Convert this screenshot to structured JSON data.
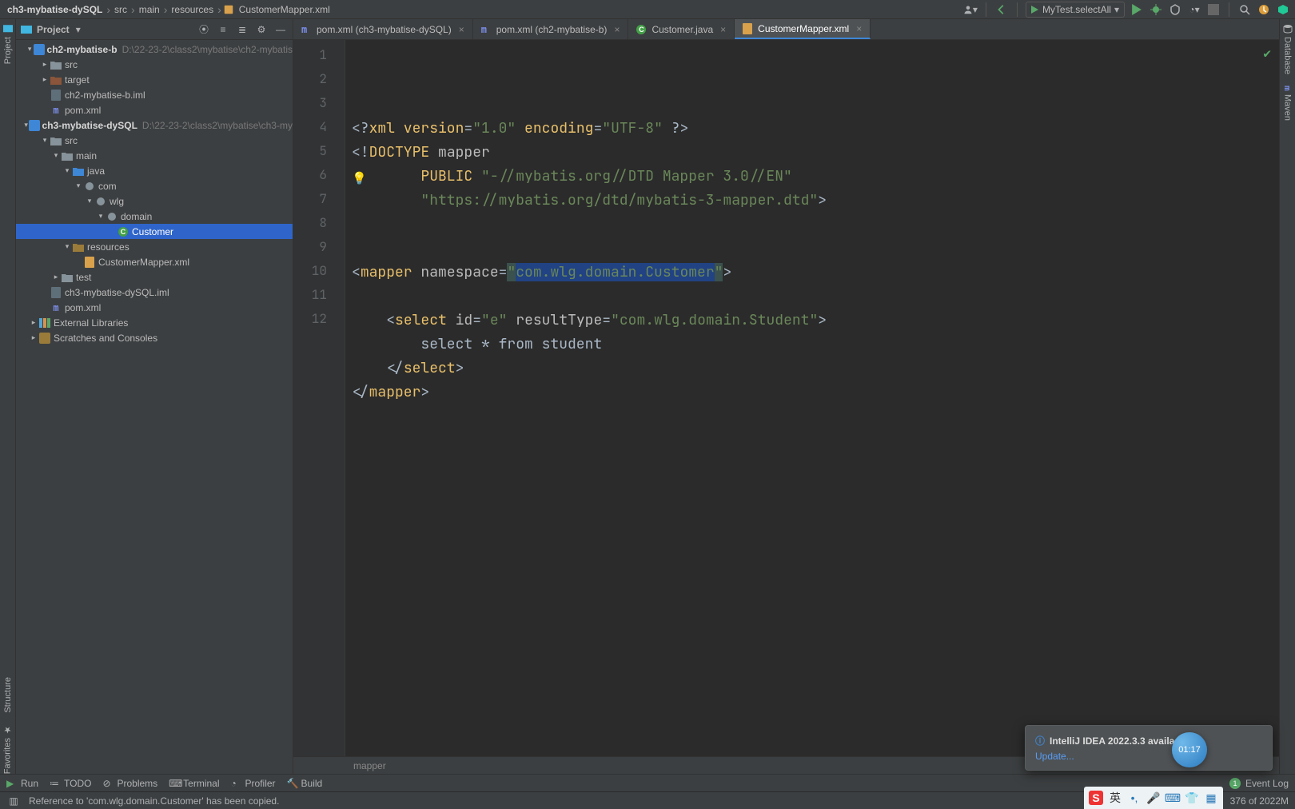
{
  "breadcrumbs": {
    "items": [
      "ch3-mybatise-dySQL",
      "src",
      "main",
      "resources",
      "CustomerMapper.xml"
    ]
  },
  "run_config": "MyTest.selectAll",
  "left_strip": {
    "project": "Project",
    "structure": "Structure",
    "favorites": "Favorites"
  },
  "right_strip": {
    "database": "Database",
    "maven": "Maven"
  },
  "project_panel": {
    "title": "Project"
  },
  "tree": [
    {
      "d": 0,
      "exp": "open",
      "icon": "module",
      "label": "ch2-mybatise-b",
      "hint": "D:\\22-23-2\\class2\\mybatise\\ch2-mybatis",
      "bold": true
    },
    {
      "d": 1,
      "exp": "closed",
      "icon": "folder",
      "label": "src"
    },
    {
      "d": 1,
      "exp": "closed",
      "icon": "folder-ex",
      "label": "target"
    },
    {
      "d": 1,
      "exp": "",
      "icon": "file",
      "label": "ch2-mybatise-b.iml"
    },
    {
      "d": 1,
      "exp": "",
      "icon": "m",
      "label": "pom.xml"
    },
    {
      "d": 0,
      "exp": "open",
      "icon": "module",
      "label": "ch3-mybatise-dySQL",
      "hint": "D:\\22-23-2\\class2\\mybatise\\ch3-my",
      "bold": true
    },
    {
      "d": 1,
      "exp": "open",
      "icon": "folder",
      "label": "src"
    },
    {
      "d": 2,
      "exp": "open",
      "icon": "folder",
      "label": "main"
    },
    {
      "d": 3,
      "exp": "open",
      "icon": "folder-blue",
      "label": "java"
    },
    {
      "d": 4,
      "exp": "open",
      "icon": "pkg",
      "label": "com"
    },
    {
      "d": 5,
      "exp": "open",
      "icon": "pkg",
      "label": "wlg"
    },
    {
      "d": 6,
      "exp": "open",
      "icon": "pkg",
      "label": "domain"
    },
    {
      "d": 7,
      "exp": "",
      "icon": "class",
      "label": "Customer",
      "selected": true
    },
    {
      "d": 3,
      "exp": "open",
      "icon": "folder-res",
      "label": "resources"
    },
    {
      "d": 4,
      "exp": "",
      "icon": "xml",
      "label": "CustomerMapper.xml"
    },
    {
      "d": 2,
      "exp": "closed",
      "icon": "folder",
      "label": "test"
    },
    {
      "d": 1,
      "exp": "",
      "icon": "file",
      "label": "ch3-mybatise-dySQL.iml"
    },
    {
      "d": 1,
      "exp": "",
      "icon": "m",
      "label": "pom.xml"
    },
    {
      "d": 0,
      "exp": "closed",
      "icon": "lib",
      "label": "External Libraries"
    },
    {
      "d": 0,
      "exp": "closed",
      "icon": "scratch",
      "label": "Scratches and Consoles"
    }
  ],
  "tabs": [
    {
      "icon": "m",
      "label": "pom.xml (ch3-mybatise-dySQL)",
      "closable": true
    },
    {
      "icon": "m",
      "label": "pom.xml (ch2-mybatise-b)",
      "closable": true
    },
    {
      "icon": "class",
      "label": "Customer.java",
      "closable": true
    },
    {
      "icon": "xml",
      "label": "CustomerMapper.xml",
      "closable": true,
      "active": true
    }
  ],
  "code": {
    "lines": [
      {
        "n": 1,
        "html": "<span class='tok-punct'>&lt;?</span><span class='tok-tag'>xml version</span><span class='tok-punct'>=</span><span class='tok-str'>\"1.0\"</span> <span class='tok-tag'>encoding</span><span class='tok-punct'>=</span><span class='tok-str'>\"UTF-8\"</span> <span class='tok-punct'>?&gt;</span>"
      },
      {
        "n": 2,
        "html": "<span class='tok-punct'>&lt;!</span><span class='tok-tag'>DOCTYPE </span><span class='tok-attr'>mapper</span>"
      },
      {
        "n": 3,
        "html": "        <span class='tok-tag'>PUBLIC</span> <span class='tok-str'>\"-//mybatis.org//DTD Mapper 3.0//EN\"</span>"
      },
      {
        "n": 4,
        "html": "        <span class='tok-str'>\"https://mybatis.org/dtd/mybatis-3-mapper.dtd\"</span><span class='tok-punct'>&gt;</span>"
      },
      {
        "n": 5,
        "html": ""
      },
      {
        "n": 6,
        "html": ""
      },
      {
        "n": 7,
        "html": "<span class='tok-punct'>&lt;</span><span class='tok-tag'>mapper </span><span class='tok-attr'>namespace</span><span class='tok-punct'>=</span><span class='hl-q tok-str'>\"</span><span class='tok-str hl-ns'>com.wlg.domain.Customer</span><span class='hl-q tok-str'>\"</span><span class='tok-punct'>&gt;</span>"
      },
      {
        "n": 8,
        "html": ""
      },
      {
        "n": 9,
        "html": "    <span class='tok-punct'>&lt;</span><span class='tok-tag'>select </span><span class='tok-attr'>id</span><span class='tok-punct'>=</span><span class='tok-str'>\"e\"</span> <span class='tok-attr'>resultType</span><span class='tok-punct'>=</span><span class='tok-str'>\"com.wlg.domain.Student\"</span><span class='tok-punct'>&gt;</span>"
      },
      {
        "n": 10,
        "html": "        select * from student"
      },
      {
        "n": 11,
        "html": "    <span class='tok-punct'>&lt;/</span><span class='tok-tag'>select</span><span class='tok-punct'>&gt;</span>"
      },
      {
        "n": 12,
        "html": "<span class='tok-punct'>&lt;/</span><span class='tok-tag'>mapper</span><span class='tok-punct'>&gt;</span>"
      }
    ],
    "crumb": "mapper"
  },
  "bottom_tools": {
    "run": "Run",
    "todo": "TODO",
    "problems": "Problems",
    "terminal": "Terminal",
    "profiler": "Profiler",
    "build": "Build",
    "event_log": "Event Log"
  },
  "statusbar": {
    "message": "Reference to 'com.wlg.domain.Customer' has been copied.",
    "memory": "376 of 2022M"
  },
  "notification": {
    "title": "IntelliJ IDEA 2022.3.3 availa",
    "link": "Update..."
  },
  "clock": "01:17"
}
